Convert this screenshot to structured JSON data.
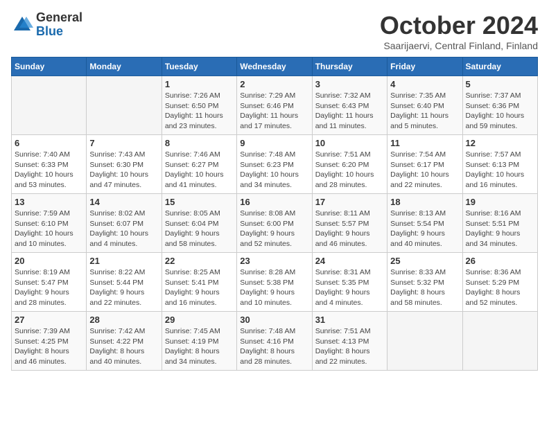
{
  "logo": {
    "general": "General",
    "blue": "Blue"
  },
  "title": "October 2024",
  "subtitle": "Saarijaervi, Central Finland, Finland",
  "days_of_week": [
    "Sunday",
    "Monday",
    "Tuesday",
    "Wednesday",
    "Thursday",
    "Friday",
    "Saturday"
  ],
  "weeks": [
    [
      {
        "day": "",
        "info": ""
      },
      {
        "day": "",
        "info": ""
      },
      {
        "day": "1",
        "info": "Sunrise: 7:26 AM\nSunset: 6:50 PM\nDaylight: 11 hours\nand 23 minutes."
      },
      {
        "day": "2",
        "info": "Sunrise: 7:29 AM\nSunset: 6:46 PM\nDaylight: 11 hours\nand 17 minutes."
      },
      {
        "day": "3",
        "info": "Sunrise: 7:32 AM\nSunset: 6:43 PM\nDaylight: 11 hours\nand 11 minutes."
      },
      {
        "day": "4",
        "info": "Sunrise: 7:35 AM\nSunset: 6:40 PM\nDaylight: 11 hours\nand 5 minutes."
      },
      {
        "day": "5",
        "info": "Sunrise: 7:37 AM\nSunset: 6:36 PM\nDaylight: 10 hours\nand 59 minutes."
      }
    ],
    [
      {
        "day": "6",
        "info": "Sunrise: 7:40 AM\nSunset: 6:33 PM\nDaylight: 10 hours\nand 53 minutes."
      },
      {
        "day": "7",
        "info": "Sunrise: 7:43 AM\nSunset: 6:30 PM\nDaylight: 10 hours\nand 47 minutes."
      },
      {
        "day": "8",
        "info": "Sunrise: 7:46 AM\nSunset: 6:27 PM\nDaylight: 10 hours\nand 41 minutes."
      },
      {
        "day": "9",
        "info": "Sunrise: 7:48 AM\nSunset: 6:23 PM\nDaylight: 10 hours\nand 34 minutes."
      },
      {
        "day": "10",
        "info": "Sunrise: 7:51 AM\nSunset: 6:20 PM\nDaylight: 10 hours\nand 28 minutes."
      },
      {
        "day": "11",
        "info": "Sunrise: 7:54 AM\nSunset: 6:17 PM\nDaylight: 10 hours\nand 22 minutes."
      },
      {
        "day": "12",
        "info": "Sunrise: 7:57 AM\nSunset: 6:13 PM\nDaylight: 10 hours\nand 16 minutes."
      }
    ],
    [
      {
        "day": "13",
        "info": "Sunrise: 7:59 AM\nSunset: 6:10 PM\nDaylight: 10 hours\nand 10 minutes."
      },
      {
        "day": "14",
        "info": "Sunrise: 8:02 AM\nSunset: 6:07 PM\nDaylight: 10 hours\nand 4 minutes."
      },
      {
        "day": "15",
        "info": "Sunrise: 8:05 AM\nSunset: 6:04 PM\nDaylight: 9 hours\nand 58 minutes."
      },
      {
        "day": "16",
        "info": "Sunrise: 8:08 AM\nSunset: 6:00 PM\nDaylight: 9 hours\nand 52 minutes."
      },
      {
        "day": "17",
        "info": "Sunrise: 8:11 AM\nSunset: 5:57 PM\nDaylight: 9 hours\nand 46 minutes."
      },
      {
        "day": "18",
        "info": "Sunrise: 8:13 AM\nSunset: 5:54 PM\nDaylight: 9 hours\nand 40 minutes."
      },
      {
        "day": "19",
        "info": "Sunrise: 8:16 AM\nSunset: 5:51 PM\nDaylight: 9 hours\nand 34 minutes."
      }
    ],
    [
      {
        "day": "20",
        "info": "Sunrise: 8:19 AM\nSunset: 5:47 PM\nDaylight: 9 hours\nand 28 minutes."
      },
      {
        "day": "21",
        "info": "Sunrise: 8:22 AM\nSunset: 5:44 PM\nDaylight: 9 hours\nand 22 minutes."
      },
      {
        "day": "22",
        "info": "Sunrise: 8:25 AM\nSunset: 5:41 PM\nDaylight: 9 hours\nand 16 minutes."
      },
      {
        "day": "23",
        "info": "Sunrise: 8:28 AM\nSunset: 5:38 PM\nDaylight: 9 hours\nand 10 minutes."
      },
      {
        "day": "24",
        "info": "Sunrise: 8:31 AM\nSunset: 5:35 PM\nDaylight: 9 hours\nand 4 minutes."
      },
      {
        "day": "25",
        "info": "Sunrise: 8:33 AM\nSunset: 5:32 PM\nDaylight: 8 hours\nand 58 minutes."
      },
      {
        "day": "26",
        "info": "Sunrise: 8:36 AM\nSunset: 5:29 PM\nDaylight: 8 hours\nand 52 minutes."
      }
    ],
    [
      {
        "day": "27",
        "info": "Sunrise: 7:39 AM\nSunset: 4:25 PM\nDaylight: 8 hours\nand 46 minutes."
      },
      {
        "day": "28",
        "info": "Sunrise: 7:42 AM\nSunset: 4:22 PM\nDaylight: 8 hours\nand 40 minutes."
      },
      {
        "day": "29",
        "info": "Sunrise: 7:45 AM\nSunset: 4:19 PM\nDaylight: 8 hours\nand 34 minutes."
      },
      {
        "day": "30",
        "info": "Sunrise: 7:48 AM\nSunset: 4:16 PM\nDaylight: 8 hours\nand 28 minutes."
      },
      {
        "day": "31",
        "info": "Sunrise: 7:51 AM\nSunset: 4:13 PM\nDaylight: 8 hours\nand 22 minutes."
      },
      {
        "day": "",
        "info": ""
      },
      {
        "day": "",
        "info": ""
      }
    ]
  ]
}
